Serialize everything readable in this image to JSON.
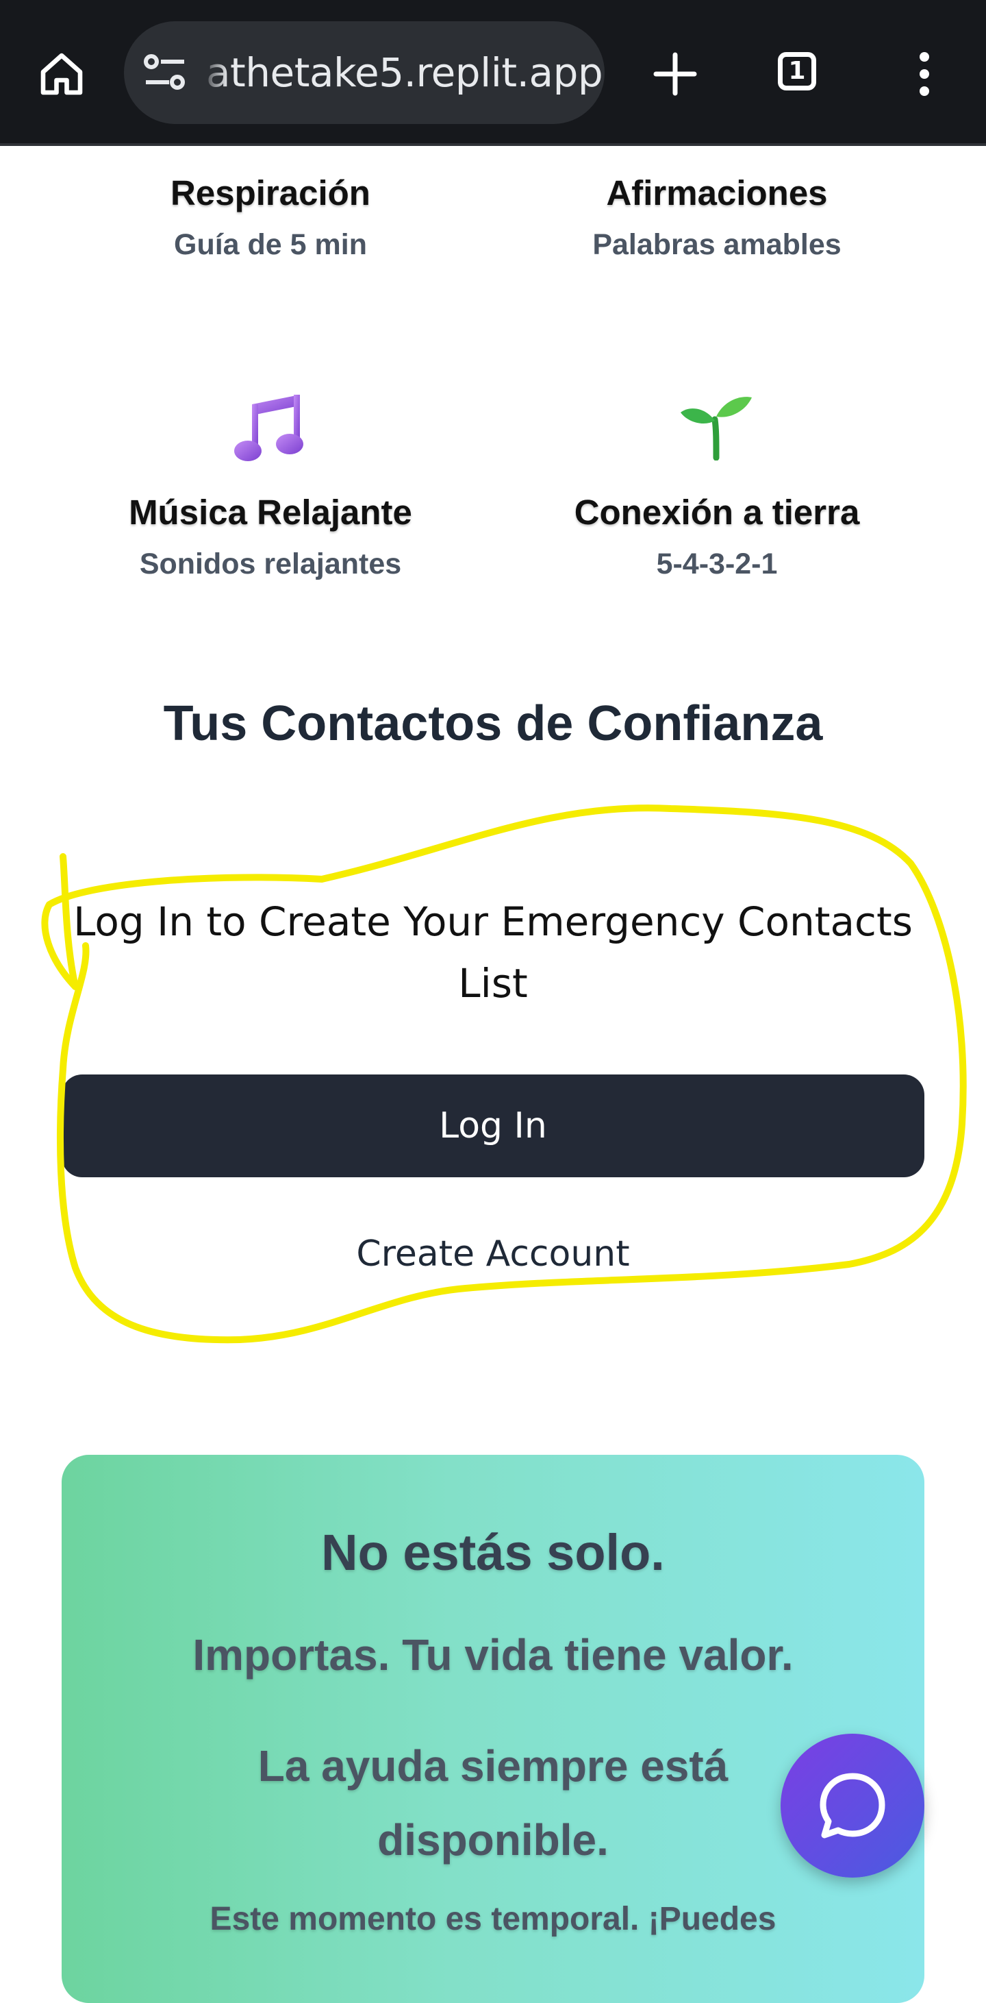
{
  "browser": {
    "url_text": "athetake5.replit.app",
    "tab_count": "1",
    "icons": [
      "home-icon",
      "site-info-icon",
      "plus-icon",
      "tab-switcher-icon",
      "more-vert-icon"
    ]
  },
  "tools": [
    {
      "title": "Respiración",
      "subtitle": "Guía de 5 min"
    },
    {
      "title": "Afirmaciones",
      "subtitle": "Palabras amables"
    },
    {
      "title": "Música Relajante",
      "subtitle": "Sonidos relajantes",
      "icon": "music-notes-icon"
    },
    {
      "title": "Conexión a tierra",
      "subtitle": "5-4-3-2-1",
      "icon": "seedling-icon"
    }
  ],
  "contacts": {
    "section_title": "Tus Contactos de Confianza",
    "prompt": "Log In to Create Your Emergency Contacts List",
    "login_label": "Log In",
    "create_account_label": "Create Account"
  },
  "support_card": {
    "line1": "No estás solo.",
    "line2": "Importas. Tu vida tiene valor.",
    "line3": "La ayuda siempre está disponible.",
    "line4": "Este momento es temporal. ¡Puedes"
  },
  "chat_fab": {
    "icon": "chat-bubble-icon"
  },
  "colors": {
    "topbar_bg": "#16181c",
    "login_button_bg": "#232936",
    "annotation_yellow": "#f5ec00",
    "card_gradient_start": "#6dd49f",
    "card_gradient_end": "#8be6ea",
    "fab_start": "#7b3fe4",
    "fab_end": "#4a5be0"
  }
}
